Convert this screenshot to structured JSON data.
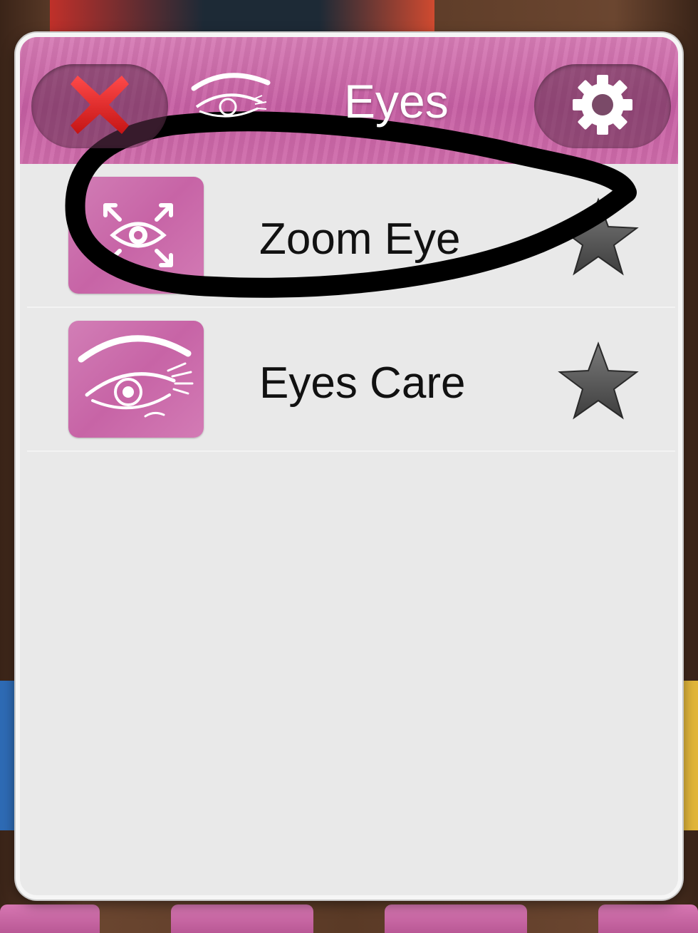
{
  "header": {
    "title": "Eyes",
    "close_icon": "close-x-icon",
    "settings_icon": "gear-icon",
    "header_icon": "eye-icon"
  },
  "list": {
    "items": [
      {
        "label": "Zoom Eye",
        "thumb_icon": "zoom-eye-icon",
        "favorite_icon": "star-icon"
      },
      {
        "label": "Eyes Care",
        "thumb_icon": "eye-care-icon",
        "favorite_icon": "star-icon"
      }
    ]
  },
  "colors": {
    "accent_pink": "#c965a6",
    "close_red": "#e02a2a",
    "panel_bg": "#e9e9e9",
    "annotation": "#000000"
  }
}
